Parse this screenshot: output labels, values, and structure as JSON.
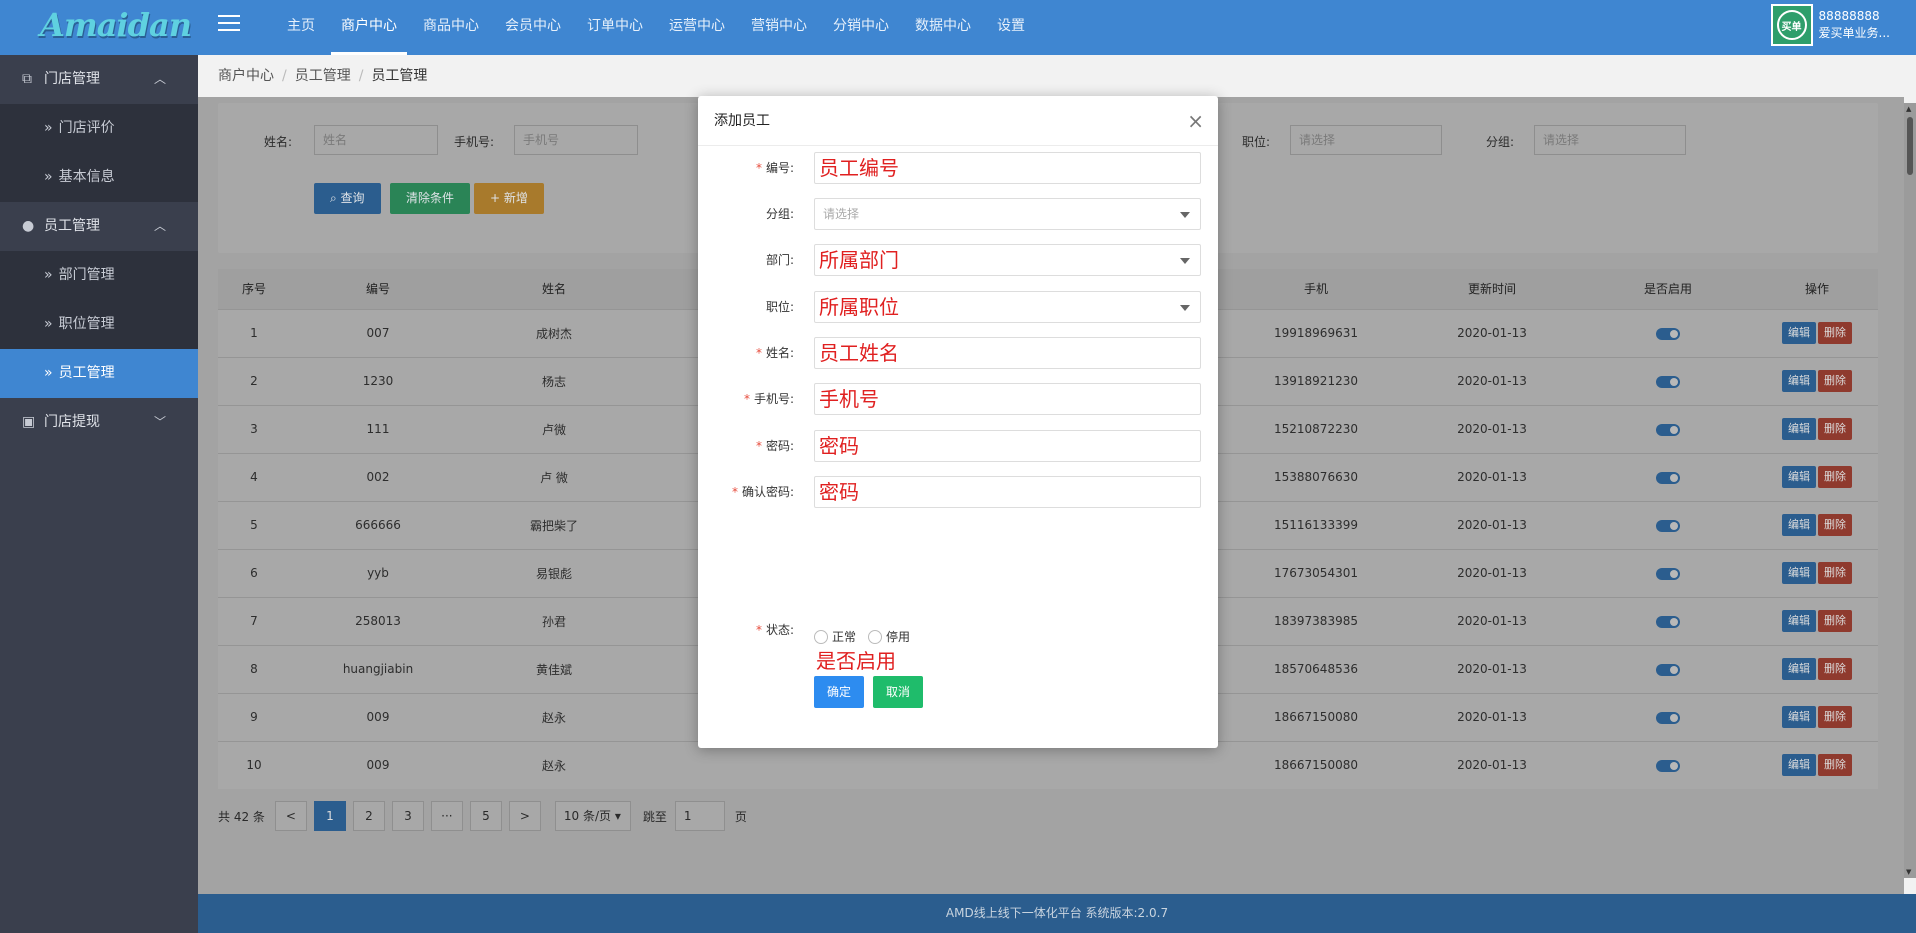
{
  "header": {
    "logo": "Amaidan",
    "nav": [
      "主页",
      "商户中心",
      "商品中心",
      "会员中心",
      "订单中心",
      "运营中心",
      "营销中心",
      "分销中心",
      "数据中心",
      "设置"
    ],
    "active_nav": "商户中心",
    "avatar_text": "买单",
    "user_id": "88888888",
    "user_name": "爱买单业务..."
  },
  "sidebar": {
    "groups": [
      {
        "label": "门店管理",
        "expanded": true,
        "items": [
          "门店评价",
          "基本信息"
        ]
      },
      {
        "label": "员工管理",
        "expanded": true,
        "items": [
          "部门管理",
          "职位管理",
          "员工管理"
        ]
      },
      {
        "label": "门店提现",
        "expanded": false,
        "items": []
      }
    ],
    "active_item": "员工管理"
  },
  "breadcrumb": [
    "商户中心",
    "员工管理",
    "员工管理"
  ],
  "filters": {
    "name_label": "姓名:",
    "name_placeholder": "姓名",
    "phone_label": "手机号:",
    "phone_placeholder": "手机号",
    "position_label": "职位:",
    "position_placeholder": "请选择",
    "group_label": "分组:",
    "group_placeholder": "请选择",
    "query_btn": "查询",
    "clear_btn": "清除条件",
    "add_btn": "+ 新增"
  },
  "table": {
    "columns": [
      "序号",
      "编号",
      "姓名",
      "手机",
      "更新时间",
      "是否启用",
      "操作"
    ],
    "rows": [
      [
        "1",
        "007",
        "成树杰",
        "19918969631",
        "2020-01-13"
      ],
      [
        "2",
        "1230",
        "杨志",
        "13918921230",
        "2020-01-13"
      ],
      [
        "3",
        "111",
        "卢微",
        "15210872230",
        "2020-01-13"
      ],
      [
        "4",
        "002",
        "卢 微",
        "15388076630",
        "2020-01-13"
      ],
      [
        "5",
        "666666",
        "霸把柴了",
        "15116133399",
        "2020-01-13"
      ],
      [
        "6",
        "yyb",
        "易银彪",
        "17673054301",
        "2020-01-13"
      ],
      [
        "7",
        "258013",
        "孙君",
        "18397383985",
        "2020-01-13"
      ],
      [
        "8",
        "huangjiabin",
        "黄佳斌",
        "18570648536",
        "2020-01-13"
      ],
      [
        "9",
        "009",
        "赵永",
        "18667150080",
        "2020-01-13"
      ],
      [
        "10",
        "009",
        "赵永",
        "18667150080",
        "2020-01-13"
      ]
    ],
    "edit_label": "编辑",
    "delete_label": "删除"
  },
  "pagination": {
    "total": "共 42 条",
    "prev": "<",
    "pages": [
      "1",
      "2",
      "3",
      "···",
      "5"
    ],
    "current": "1",
    "next": ">",
    "page_size": "10 条/页",
    "goto_label": "跳至",
    "goto_value": "1",
    "page_unit": "页"
  },
  "footer": "AMD线上线下一体化平台 系统版本:2.0.7",
  "modal": {
    "title": "添加员工",
    "fields": [
      {
        "label": "编号:",
        "required": true,
        "value": "员工编号",
        "type": "text"
      },
      {
        "label": "分组:",
        "required": false,
        "value": "请选择",
        "type": "select",
        "placeholder": true
      },
      {
        "label": "部门:",
        "required": false,
        "value": "所属部门",
        "type": "select"
      },
      {
        "label": "职位:",
        "required": false,
        "value": "所属职位",
        "type": "select"
      },
      {
        "label": "姓名:",
        "required": true,
        "value": "员工姓名",
        "type": "text"
      },
      {
        "label": "手机号:",
        "required": true,
        "value": "手机号",
        "type": "text"
      },
      {
        "label": "密码:",
        "required": true,
        "value": "密码",
        "type": "text"
      },
      {
        "label": "确认密码:",
        "required": true,
        "value": "密码",
        "type": "text"
      }
    ],
    "status_label": "状态:",
    "status_options": [
      "正常",
      "停用"
    ],
    "status_hint": "是否启用",
    "confirm_btn": "确定",
    "cancel_btn": "取消"
  },
  "colors": {
    "primary": "#3f86d1",
    "sidebar": "#3a3f4d",
    "danger": "#e74c3c",
    "success": "#1fbc6b",
    "warning": "#f0a126",
    "annotation": "#e02020"
  }
}
